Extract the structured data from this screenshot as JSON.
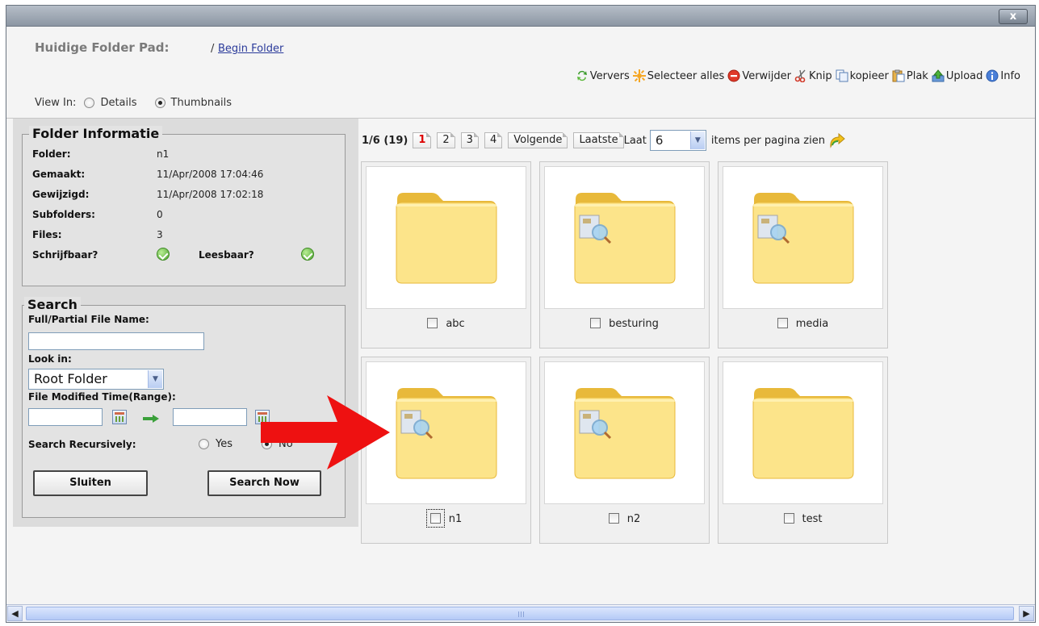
{
  "window": {
    "close_label": "x"
  },
  "header": {
    "path_label": "Huidige Folder Pad:",
    "path_separator": "/",
    "path_link": "Begin Folder",
    "view_in_label": "View In:",
    "view_options": [
      "Details",
      "Thumbnails"
    ],
    "view_selected": "Thumbnails"
  },
  "toolbar": {
    "items": [
      {
        "label": "Ververs",
        "icon": "refresh-icon"
      },
      {
        "label": "Selecteer alles",
        "icon": "select-all-icon"
      },
      {
        "label": "Verwijder",
        "icon": "delete-icon"
      },
      {
        "label": "Knip",
        "icon": "scissors-icon"
      },
      {
        "label": "kopieer",
        "icon": "copy-icon"
      },
      {
        "label": "Plak",
        "icon": "paste-icon"
      },
      {
        "label": "Upload",
        "icon": "upload-icon"
      },
      {
        "label": "Info",
        "icon": "info-icon"
      }
    ]
  },
  "folder_info": {
    "title": "Folder Informatie",
    "rows": [
      {
        "key": "Folder:",
        "value": "n1"
      },
      {
        "key": "Gemaakt:",
        "value": "11/Apr/2008 17:04:46"
      },
      {
        "key": "Gewijzigd:",
        "value": "11/Apr/2008 17:02:18"
      },
      {
        "key": "Subfolders:",
        "value": "0"
      },
      {
        "key": "Files:",
        "value": "3"
      }
    ],
    "writable_label": "Schrijfbaar?",
    "readable_label": "Leesbaar?"
  },
  "search": {
    "title": "Search",
    "name_label": "Full/Partial File Name:",
    "name_value": "",
    "look_in_label": "Look in:",
    "look_in_value": "Root Folder",
    "modified_label": "File Modified Time(Range):",
    "from_value": "",
    "to_value": "",
    "recursive_label": "Search Recursively:",
    "recursive_yes": "Yes",
    "recursive_no": "No",
    "recursive_selected": "No",
    "close_button": "Sluiten",
    "search_button": "Search Now"
  },
  "pager": {
    "summary": "1/6 (19)",
    "pages": [
      "1",
      "2",
      "3",
      "4"
    ],
    "current_page": "1",
    "next_label": "Volgende",
    "last_label": "Laatste",
    "show_label": "Laat",
    "per_page_value": "6",
    "per_page_suffix": "items per pagina zien"
  },
  "items": [
    {
      "name": "abc",
      "has_content": false
    },
    {
      "name": "besturing",
      "has_content": true
    },
    {
      "name": "media",
      "has_content": true
    },
    {
      "name": "n1",
      "has_content": true
    },
    {
      "name": "n2",
      "has_content": true
    },
    {
      "name": "test",
      "has_content": false
    }
  ],
  "colors": {
    "folder_light": "#fce48a",
    "folder_dark": "#e8b93a",
    "arrow_red": "#ee1111",
    "current_page": "#dd0000"
  }
}
